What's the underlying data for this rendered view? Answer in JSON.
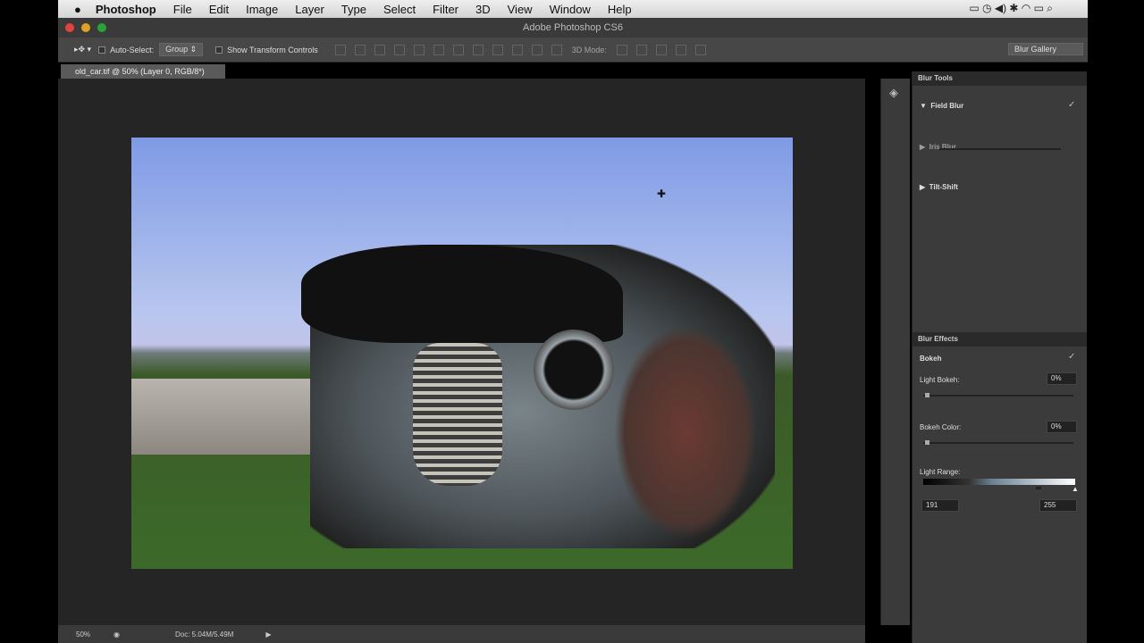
{
  "menubar": {
    "apple": "",
    "app": "Photoshop",
    "items": [
      "File",
      "Edit",
      "Image",
      "Layer",
      "Type",
      "Select",
      "Filter",
      "3D",
      "View",
      "Window",
      "Help"
    ],
    "status_icons": "▭ ◷ ◀) ✱ ◠ ▭ ⌕"
  },
  "window": {
    "title": "Adobe Photoshop CS6"
  },
  "options": {
    "auto_select": "Auto-Select:",
    "group": "Group",
    "show_transform": "Show Transform Controls",
    "mode_3d": "3D Mode:",
    "workspace": "Blur Gallery"
  },
  "document": {
    "tab": "old_car.tif @ 50% (Layer 0, RGB/8*)"
  },
  "blur_tools": {
    "header": "Blur Tools",
    "field_blur": "Field Blur",
    "iris_blur": "Iris Blur",
    "tilt_shift": "Tilt-Shift"
  },
  "blur_effects": {
    "header": "Blur Effects",
    "bokeh": "Bokeh",
    "light_bokeh": "Light Bokeh:",
    "light_bokeh_value": "0%",
    "bokeh_color": "Bokeh Color:",
    "bokeh_color_value": "0%",
    "light_range": "Light Range:",
    "range_low": "191",
    "range_high": "255"
  },
  "status": {
    "zoom": "50%",
    "doc": "Doc: 5.04M/5.49M"
  }
}
